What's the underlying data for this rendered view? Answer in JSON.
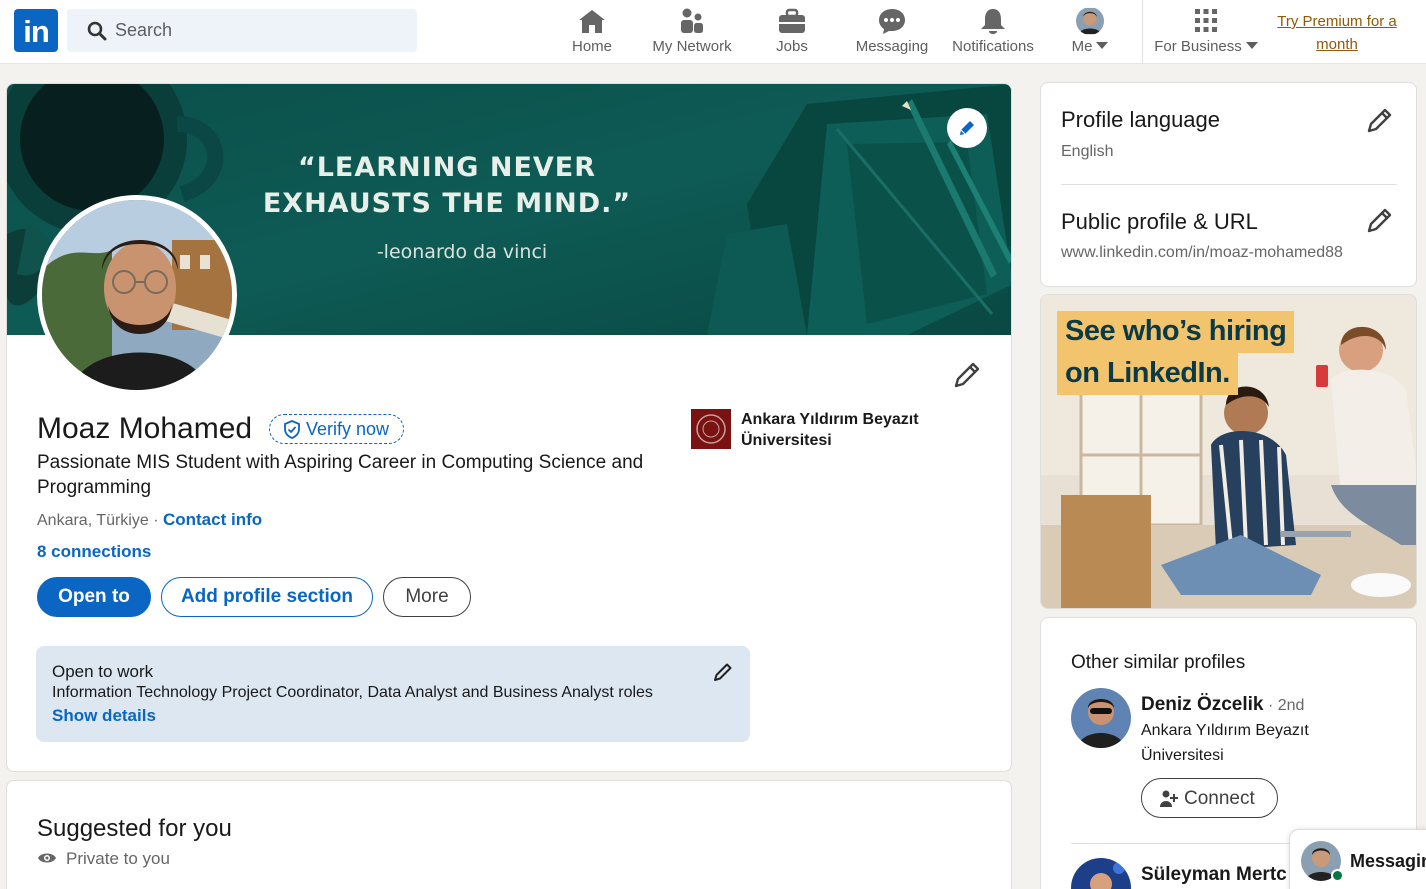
{
  "nav": {
    "logo": "in",
    "search_placeholder": "Search",
    "items": [
      {
        "label": "Home",
        "icon": "home-icon"
      },
      {
        "label": "My Network",
        "icon": "network-icon"
      },
      {
        "label": "Jobs",
        "icon": "briefcase-icon"
      },
      {
        "label": "Messaging",
        "icon": "chat-icon"
      },
      {
        "label": "Notifications",
        "icon": "bell-icon"
      },
      {
        "label": "Me",
        "icon": "avatar"
      },
      {
        "label": "For Business",
        "icon": "grid-icon"
      }
    ],
    "premium_label": "Try Premium for a month"
  },
  "profile": {
    "banner_quote_line1": "“LEARNING NEVER",
    "banner_quote_line2": "EXHAUSTS THE MIND.”",
    "banner_author": "-leonardo da vinci",
    "name": "Moaz Mohamed",
    "verify_label": "Verify now",
    "headline": "Passionate MIS Student with Aspiring Career in Computing Science and Programming",
    "location": "Ankara, Türkiye",
    "separator": " · ",
    "contact_label": "Contact info",
    "connections": "8 connections",
    "buttons": {
      "open_to": "Open to",
      "add_section": "Add profile section",
      "more": "More"
    },
    "school": "Ankara Yıldırım Beyazıt Üniversitesi",
    "open_to_work": {
      "title": "Open to work",
      "roles": "Information Technology Project Coordinator, Data Analyst and Business Analyst roles",
      "show_details": "Show details"
    }
  },
  "suggested": {
    "title": "Suggested for you",
    "privacy": "Private to you"
  },
  "sidebar": {
    "profile_language": {
      "title": "Profile language",
      "value": "English"
    },
    "public_url": {
      "title": "Public profile & URL",
      "value": "www.linkedin.com/in/moaz-mohamed88"
    },
    "ad": {
      "line1": "See who’s hiring",
      "line2": "on LinkedIn."
    },
    "similar": {
      "title": "Other similar profiles",
      "people": [
        {
          "name": "Deniz Özcelik",
          "degree": " · 2nd",
          "subtitle": "Ankara Yıldırım Beyazıt Üniversitesi",
          "action": "Connect"
        },
        {
          "name": "Süleyman Mertc"
        }
      ]
    }
  },
  "messaging_dock": {
    "label": "Messaging"
  },
  "colors": {
    "brand": "#0a66c2",
    "premium": "#915907",
    "open_to_work_bg": "#dde7f1",
    "banner": "#0e5752",
    "ad_highlight": "#f3c46e"
  }
}
